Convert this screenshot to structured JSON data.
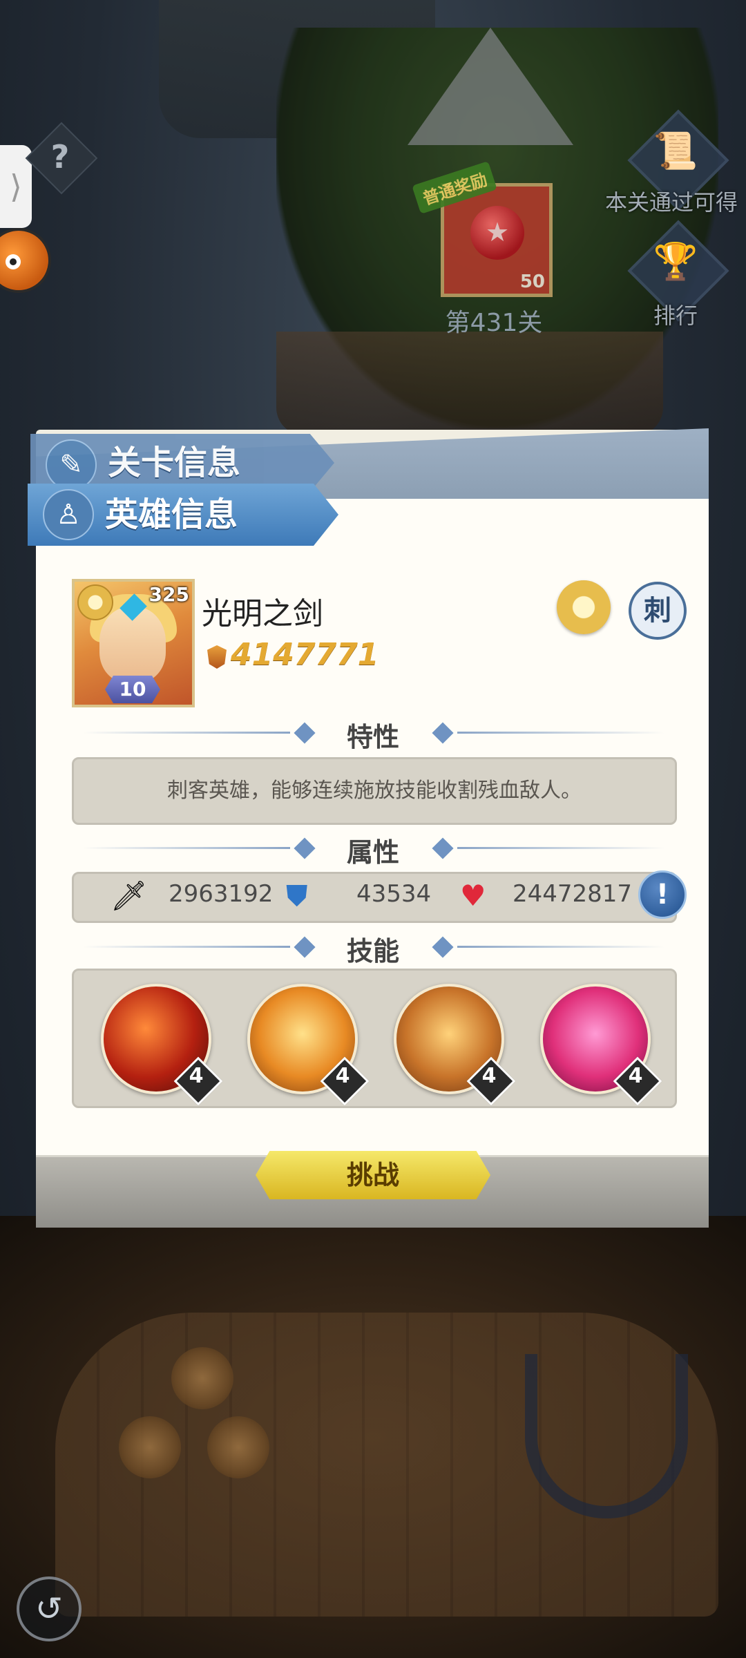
{
  "hud": {
    "side_tab_glyph": "⟩",
    "help_glyph": "?",
    "reward_tag": "普通奖励",
    "reward_count": "50",
    "stage_label": "第431关",
    "pass_reward_label": "本关通过可得",
    "rank_label": "排行"
  },
  "dialog": {
    "tab_stage": "关卡信息",
    "tab_hero": "英雄信息",
    "hero": {
      "power_badge": "325",
      "level": "10",
      "name": "光明之剑",
      "combat_power": "4147771",
      "class_glyph": "刺"
    },
    "sections": {
      "trait": "特性",
      "attributes": "属性",
      "skills": "技能"
    },
    "trait_text": "刺客英雄，能够连续施放技能收割残血敌人。",
    "attributes": {
      "attack": "2963192",
      "defense": "43534",
      "hp": "24472817",
      "info_glyph": "!"
    },
    "skills": [
      {
        "level": "4"
      },
      {
        "level": "4"
      },
      {
        "level": "4"
      },
      {
        "level": "4"
      }
    ],
    "challenge_button": "挑战"
  },
  "icons": {
    "sword": "sword-icon",
    "shield": "shield-icon",
    "heart": "heart-icon",
    "back": "back-icon"
  },
  "colors": {
    "tab_blue": "#3e7ab8",
    "power_gold": "#e4a932",
    "challenge_yellow": "#d9b621"
  }
}
